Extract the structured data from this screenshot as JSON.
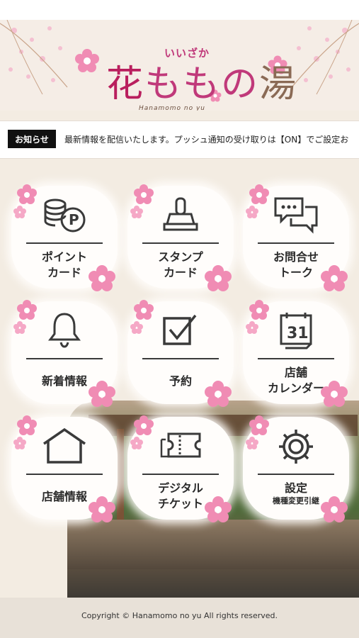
{
  "header": {
    "logo_small": "いいざか",
    "logo_main_1": "花",
    "logo_main_2": "ももの",
    "logo_main_3": "湯",
    "logo_sub": "Hanamomo no yu"
  },
  "news": {
    "label": "お知らせ",
    "text": "最新情報を配信いたします。プッシュ通知の受け取りは【ON】でご設定お"
  },
  "tiles": [
    {
      "line1": "ポイント",
      "line2": "カード"
    },
    {
      "line1": "スタンプ",
      "line2": "カード"
    },
    {
      "line1": "お問合せ",
      "line2": "トーク"
    },
    {
      "line1": "新着情報"
    },
    {
      "line1": "予約"
    },
    {
      "line1": "店舗",
      "line2": "カレンダー"
    },
    {
      "line1": "店舗情報"
    },
    {
      "line1": "デジタル",
      "line2": "チケット"
    },
    {
      "line1": "設定",
      "line2": "機種変更引継"
    }
  ],
  "calendar_day": "31",
  "footer": {
    "copyright": "Copyright © Hanamomo no yu All rights reserved."
  },
  "colors": {
    "accent": "#c0397a",
    "flower": "#f08cb4",
    "bg": "#f3ece2"
  }
}
